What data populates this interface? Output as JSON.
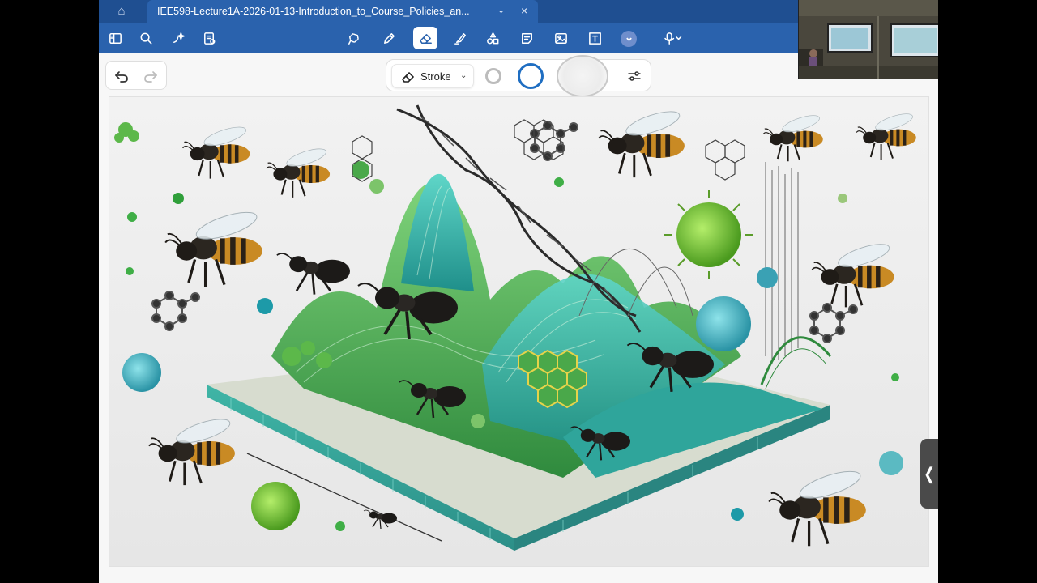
{
  "tab_bar": {
    "document_title": "IEE598-Lecture1A-2026-01-13-Introduction_to_Course_Policies_an...",
    "home_icon": "home-icon",
    "chevron_icon": "chevron-down-icon",
    "close_icon": "close-icon"
  },
  "toolbar": {
    "active_tool": "eraser",
    "tools": [
      "sidebar-toggle-icon",
      "search-icon",
      "ai-sparkle-icon",
      "document-icon",
      "lasso-icon",
      "pen-icon",
      "eraser-icon",
      "highlighter-icon",
      "shapes-icon",
      "sticky-note-icon",
      "image-icon",
      "text-box-icon",
      "more-icon",
      "microphone-icon"
    ]
  },
  "pen_bar": {
    "stroke_label": "Stroke",
    "sizes": [
      "small",
      "medium",
      "large"
    ],
    "selected_size": "medium",
    "accent_color": "#1f6ec2"
  },
  "side_handle": {
    "glyph": "❬"
  },
  "colors": {
    "titlebar": "#1f4f91",
    "toolbar": "#2a62ad",
    "canvas": "#f7f7f7"
  }
}
